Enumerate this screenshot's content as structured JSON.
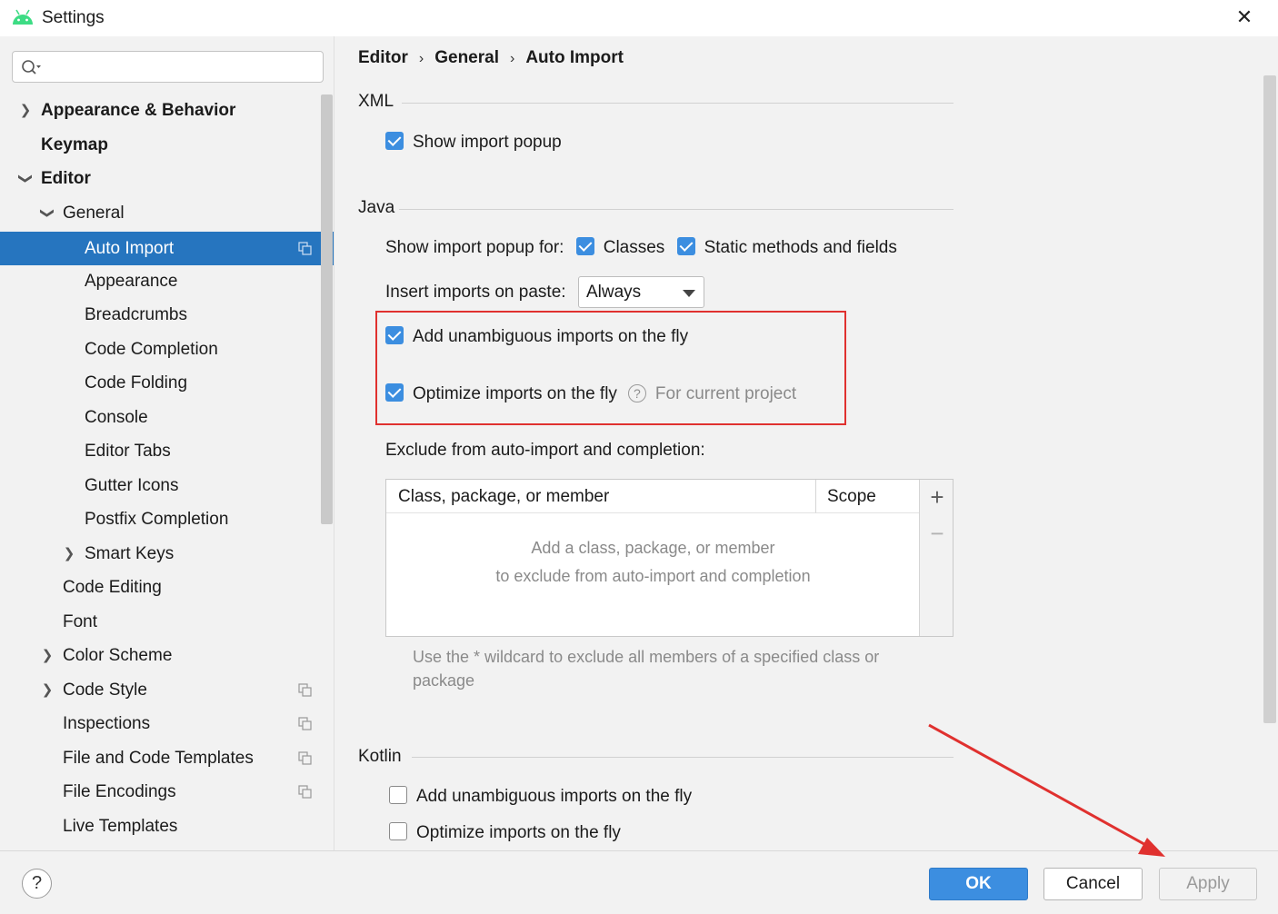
{
  "window": {
    "title": "Settings",
    "close_label": "✕"
  },
  "search": {
    "value": "",
    "placeholder": ""
  },
  "sidebar": {
    "items": [
      {
        "label": "Appearance & Behavior"
      },
      {
        "label": "Keymap"
      },
      {
        "label": "Editor"
      },
      {
        "label": "General"
      },
      {
        "label": "Auto Import"
      },
      {
        "label": "Appearance"
      },
      {
        "label": "Breadcrumbs"
      },
      {
        "label": "Code Completion"
      },
      {
        "label": "Code Folding"
      },
      {
        "label": "Console"
      },
      {
        "label": "Editor Tabs"
      },
      {
        "label": "Gutter Icons"
      },
      {
        "label": "Postfix Completion"
      },
      {
        "label": "Smart Keys"
      },
      {
        "label": "Code Editing"
      },
      {
        "label": "Font"
      },
      {
        "label": "Color Scheme"
      },
      {
        "label": "Code Style"
      },
      {
        "label": "Inspections"
      },
      {
        "label": "File and Code Templates"
      },
      {
        "label": "File Encodings"
      },
      {
        "label": "Live Templates"
      }
    ]
  },
  "breadcrumb": {
    "items": [
      "Editor",
      "General",
      "Auto Import"
    ],
    "separator": "›"
  },
  "xml": {
    "title": "XML",
    "show_import_popup": {
      "label": "Show import popup",
      "checked": true
    }
  },
  "java": {
    "title": "Java",
    "show_popup_for_label": "Show import popup for:",
    "classes": {
      "label": "Classes",
      "checked": true
    },
    "static_methods": {
      "label": "Static methods and fields",
      "checked": true
    },
    "insert_on_paste_label": "Insert imports on paste:",
    "insert_on_paste_value": "Always",
    "add_unambiguous": {
      "label": "Add unambiguous imports on the fly",
      "checked": true
    },
    "optimize_imports": {
      "label": "Optimize imports on the fly",
      "checked": true,
      "hint": "For current project",
      "help_glyph": "?"
    },
    "exclude_label": "Exclude from auto-import and completion:",
    "table": {
      "columns": [
        "Class, package, or member",
        "Scope"
      ],
      "add_glyph": "+",
      "remove_glyph": "−",
      "empty_line1": "Add a class, package, or member",
      "empty_line2": "to exclude from auto-import and completion"
    },
    "note": "Use the * wildcard to exclude all members of a specified class or package"
  },
  "kotlin": {
    "title": "Kotlin",
    "add_unambiguous": {
      "label": "Add unambiguous imports on the fly",
      "checked": false
    },
    "optimize_imports": {
      "label": "Optimize imports on the fly",
      "checked": false
    }
  },
  "buttons": {
    "help": "?",
    "ok": "OK",
    "cancel": "Cancel",
    "apply": "Apply"
  },
  "colors": {
    "accent": "#3c8ee0",
    "selection": "#2675bf",
    "annotation_red": "#e0312f"
  },
  "icons": {
    "app": "android-icon",
    "search": "search-icon",
    "copy": "copy-icon"
  }
}
